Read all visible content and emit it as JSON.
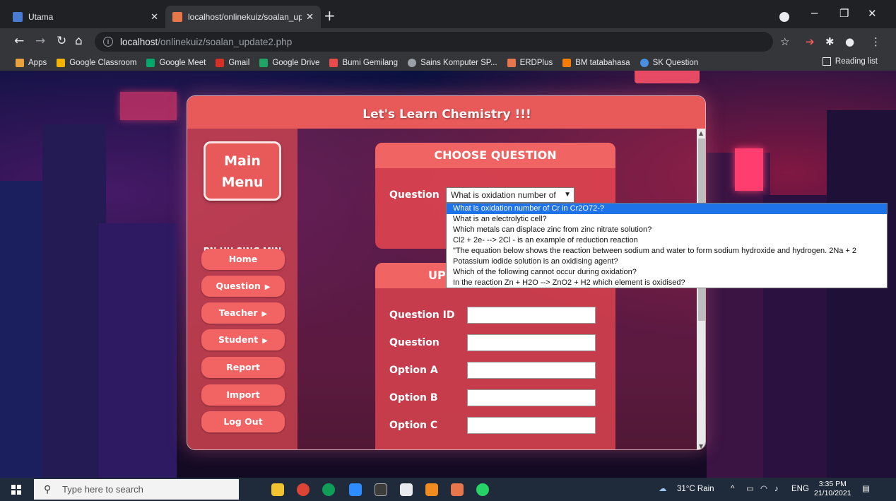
{
  "browser": {
    "tabs": [
      {
        "title": "Utama",
        "active": false
      },
      {
        "title": "localhost/onlinekuiz/soalan_upd",
        "active": true
      }
    ],
    "url_host": "localhost",
    "url_path": "/onlinekuiz/soalan_update2.php",
    "bookmarks": [
      "Apps",
      "Google Classroom",
      "Google Meet",
      "Gmail",
      "Google Drive",
      "Bumi Gemilang",
      "Sains Komputer SP...",
      "ERDPlus",
      "BM tatabahasa",
      "SK Question"
    ],
    "reading_list": "Reading list"
  },
  "app": {
    "title": "Let's Learn Chemistry !!!",
    "main_menu": "Main Menu",
    "teacher": "PN HU SING MIN",
    "menu": [
      {
        "label": "Home",
        "arrow": ""
      },
      {
        "label": "Question",
        "arrow": "▶"
      },
      {
        "label": "Teacher",
        "arrow": "▶"
      },
      {
        "label": "Student",
        "arrow": "▶"
      },
      {
        "label": "Report",
        "arrow": ""
      },
      {
        "label": "Import",
        "arrow": ""
      },
      {
        "label": "Log Out",
        "arrow": ""
      }
    ],
    "choose": {
      "heading": "CHOOSE QUESTION",
      "label": "Question",
      "selected": "What is oxidation number of"
    },
    "update": {
      "heading": "UP",
      "fields": [
        "Question ID",
        "Question",
        "Option A",
        "Option B",
        "Option C"
      ]
    },
    "dropdown_options": [
      "What is oxidation number of Cr in Cr2O72-?",
      "What is an electrolytic cell?",
      "Which metals can displace zinc from zinc nitrate solution?",
      "Cl2 + 2e- --> 2Cl - is an example of reduction reaction",
      "\"The equation below shows the reaction between sodium and water to form sodium hydroxide and hydrogen. 2Na + 2",
      "Potassium iodide solution is an oxidising agent?",
      "Which of the following cannot occur during oxidation?",
      "In the reaction Zn + H2O --> ZnO2 + H2 which element is oxidised?"
    ]
  },
  "taskbar": {
    "search_placeholder": "Type here to search",
    "weather": "31°C Rain",
    "lang": "ENG",
    "time": "3:35 PM",
    "date": "21/10/2021"
  }
}
